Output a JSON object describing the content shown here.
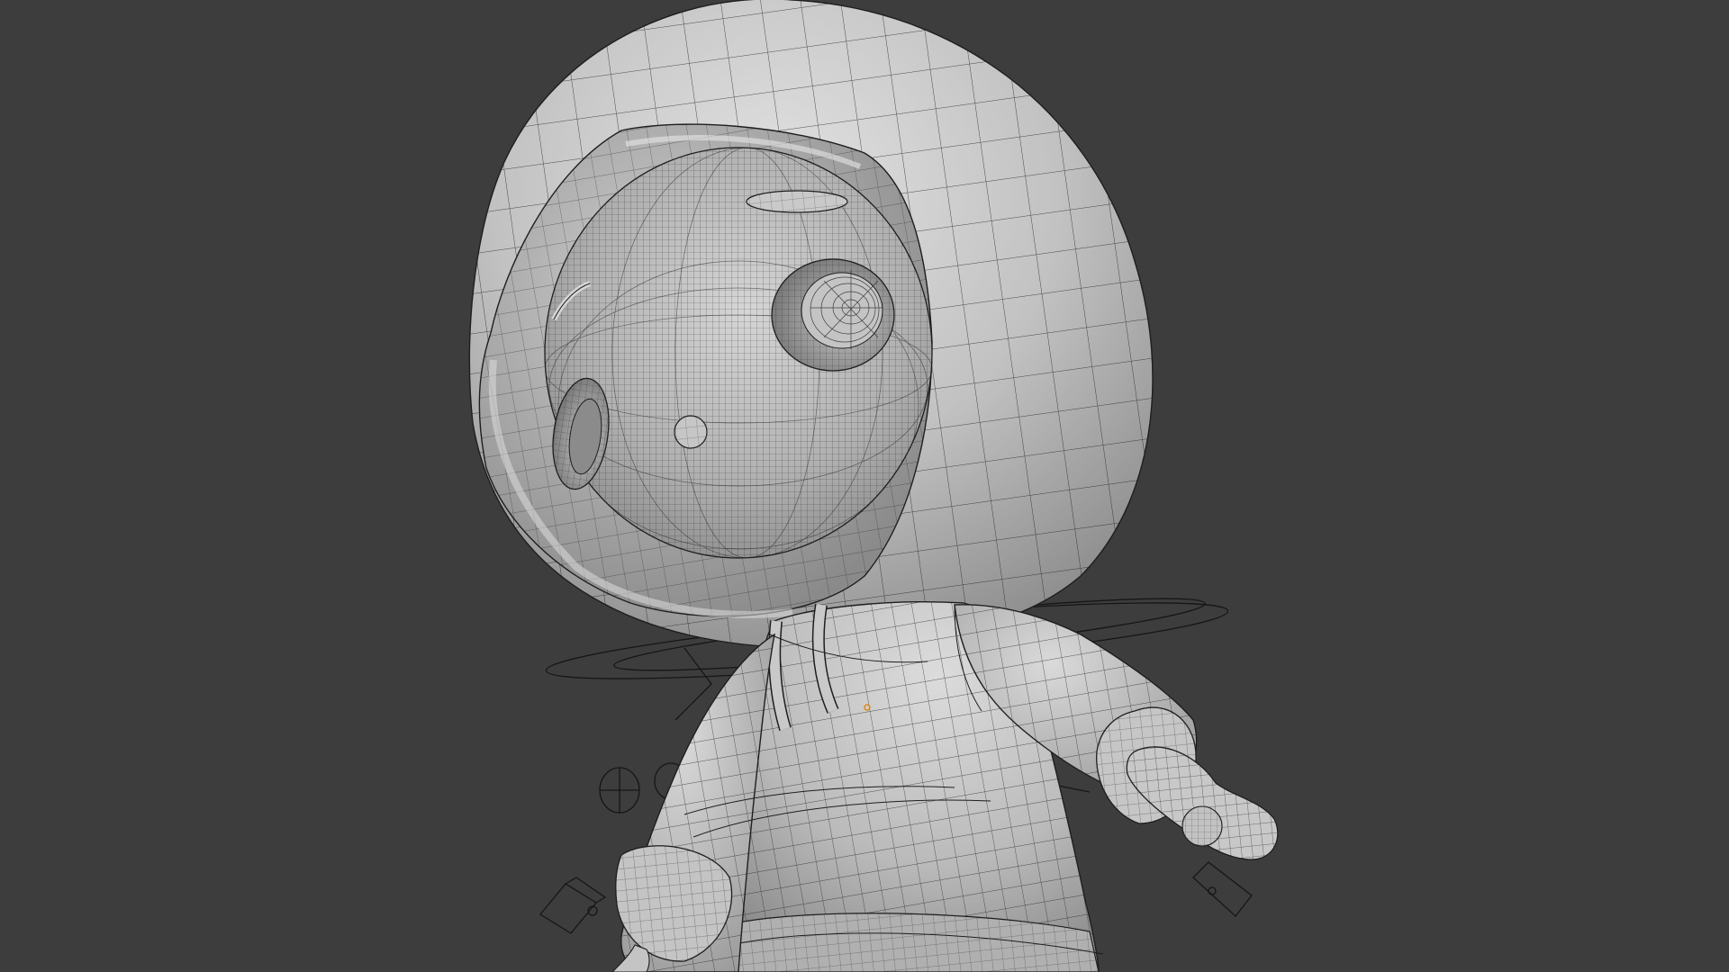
{
  "viewport": {
    "background_color": "#3d3d3d",
    "mesh_base_color": "#b9b9b9",
    "mesh_highlight_color": "#e3e3e3",
    "mesh_shadow_color": "#7d7d7d",
    "wire_color": "#1e1e1e",
    "rig_line_color": "#161616",
    "origin_marker_color": "#d98a1c"
  },
  "model": {
    "subject": "character-mesh",
    "display_mode": "wireframe-over-solid"
  },
  "icons": {
    "origin_marker": "origin-dot-icon",
    "camera_gizmo": "camera-icon",
    "empty_gizmo": "empty-axes-icon"
  }
}
